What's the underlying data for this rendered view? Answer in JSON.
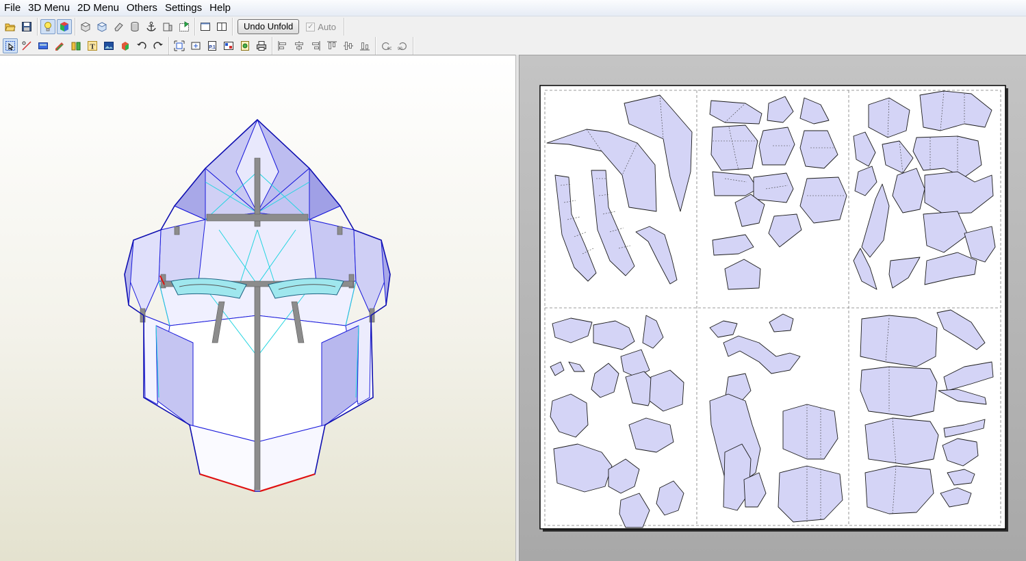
{
  "menu": {
    "items": [
      "File",
      "3D Menu",
      "2D Menu",
      "Others",
      "Settings",
      "Help"
    ]
  },
  "toolbar_top": {
    "undo_unfold_label": "Undo Unfold",
    "auto_label": "Auto",
    "auto_checked": true,
    "icons": [
      "open-icon",
      "save-icon",
      "light-icon",
      "color-cube-icon",
      "box-icon",
      "box-edit-icon",
      "eraser-icon",
      "cylinder-icon",
      "anchor-icon",
      "part-icon",
      "map-icon",
      "single-view-icon",
      "dual-view-icon"
    ]
  },
  "toolbar_bottom": {
    "icons": [
      "select-icon",
      "edge-icon",
      "texture-icon",
      "brush-icon",
      "join-icon",
      "text-icon",
      "image-icon",
      "color-icon",
      "rotate-left-icon",
      "rotate-right-icon",
      "fit-icon",
      "flip-icon",
      "page-icon",
      "print-setup-icon",
      "settings-icon",
      "print-icon",
      "align-left-icon",
      "align-center-icon",
      "align-right-icon",
      "align-top-icon",
      "align-middle-icon",
      "align-bottom-icon",
      "rotate-90-left-icon",
      "rotate-90-right-icon"
    ],
    "rotate_left_label": "90",
    "rotate_right_label": "90"
  },
  "colors": {
    "face_fill": "#d9d9f7",
    "face_fill_light": "#f5f5ff",
    "edge_blue": "#1a1adb",
    "edge_cyan": "#22d4e0",
    "edge_red": "#e01010",
    "shadow_gray": "#8c8c8c",
    "piece_fill": "#d4d4f6"
  },
  "view2d": {
    "pages_cols": 3,
    "pages_rows": 2
  }
}
